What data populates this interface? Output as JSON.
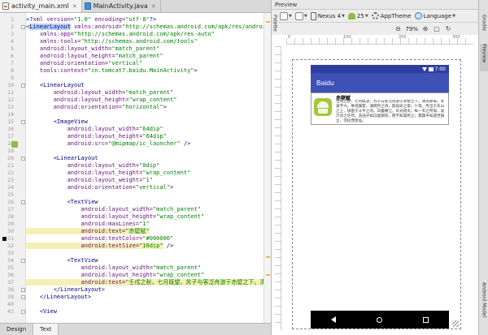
{
  "editor": {
    "tabs": [
      {
        "label": "activity_main.xml",
        "icon": "xml-file-icon",
        "active": true
      },
      {
        "label": "MainActivity.java",
        "icon": "java-file-icon",
        "active": false
      }
    ],
    "bottom_tabs": [
      "Design",
      "Text"
    ],
    "lines": [
      {
        "n": "1",
        "segs": [
          [
            "t",
            "<?"
          ],
          [
            "a",
            "xml version="
          ],
          [
            "v",
            "\"1.0\""
          ],
          [
            "a",
            " encoding="
          ],
          [
            "v",
            "\"utf-8\""
          ],
          [
            "t",
            "?>"
          ]
        ]
      },
      {
        "n": "2",
        "segs": [
          [
            "t",
            "<"
          ],
          [
            "sel",
            "LinearLayout"
          ],
          [
            "a",
            " xmlns:android="
          ],
          [
            "v",
            "\"http://schemas.android.com/apk/res/android\""
          ]
        ]
      },
      {
        "n": "3",
        "segs": [
          [
            "a",
            "    xmlns:app="
          ],
          [
            "v",
            "\"http://schemas.android.com/apk/res-auto\""
          ]
        ]
      },
      {
        "n": "4",
        "segs": [
          [
            "a",
            "    xmlns:tools="
          ],
          [
            "v",
            "\"http://schemas.android.com/tools\""
          ]
        ]
      },
      {
        "n": "5",
        "segs": [
          [
            "a",
            "    android:layout_width="
          ],
          [
            "v",
            "\"match_parent\""
          ]
        ]
      },
      {
        "n": "6",
        "segs": [
          [
            "a",
            "    android:layout_height="
          ],
          [
            "v",
            "\"match_parent\""
          ]
        ]
      },
      {
        "n": "7",
        "segs": [
          [
            "a",
            "    android:orientation="
          ],
          [
            "v",
            "\"vertical\""
          ]
        ]
      },
      {
        "n": "8",
        "segs": [
          [
            "a",
            "    tools:context="
          ],
          [
            "v",
            "\"cn.tomcat7.baidu.MainActivity\""
          ],
          [
            "t",
            ">"
          ]
        ]
      },
      {
        "n": "9",
        "segs": []
      },
      {
        "n": "10",
        "segs": [
          [
            "t",
            "    <LinearLayout"
          ]
        ]
      },
      {
        "n": "11",
        "segs": [
          [
            "a",
            "        android:layout_width="
          ],
          [
            "v",
            "\"match_parent\""
          ]
        ]
      },
      {
        "n": "12",
        "segs": [
          [
            "a",
            "        android:layout_height="
          ],
          [
            "v",
            "\"wrap_content\""
          ]
        ]
      },
      {
        "n": "13",
        "segs": [
          [
            "a",
            "        android:orientation="
          ],
          [
            "v",
            "\"horizontal\""
          ],
          [
            "t",
            ">"
          ]
        ]
      },
      {
        "n": "14",
        "segs": []
      },
      {
        "n": "15",
        "segs": [
          [
            "t",
            "        <ImageView"
          ]
        ]
      },
      {
        "n": "16",
        "segs": [
          [
            "a",
            "            android:layout_width="
          ],
          [
            "v",
            "\"64dip\""
          ]
        ]
      },
      {
        "n": "17",
        "segs": [
          [
            "a",
            "            android:layout_height="
          ],
          [
            "v",
            "\"64dip\""
          ]
        ]
      },
      {
        "n": "18",
        "segs": [
          [
            "a",
            "            android:src="
          ],
          [
            "v",
            "\"@mipmap/ic_launcher\""
          ],
          [
            "t",
            " />"
          ]
        ]
      },
      {
        "n": "19",
        "segs": []
      },
      {
        "n": "20",
        "segs": [
          [
            "t",
            "        <LinearLayout"
          ]
        ]
      },
      {
        "n": "21",
        "segs": [
          [
            "a",
            "            android:layout_width="
          ],
          [
            "v",
            "\"0dip\""
          ]
        ]
      },
      {
        "n": "22",
        "segs": [
          [
            "a",
            "            android:layout_height="
          ],
          [
            "v",
            "\"wrap_content\""
          ]
        ]
      },
      {
        "n": "23",
        "segs": [
          [
            "a",
            "            android:layout_weight="
          ],
          [
            "v",
            "\"1\""
          ]
        ]
      },
      {
        "n": "24",
        "segs": [
          [
            "a",
            "            android:orientation="
          ],
          [
            "v",
            "\"vertical\""
          ],
          [
            "t",
            ">"
          ]
        ]
      },
      {
        "n": "25",
        "segs": []
      },
      {
        "n": "26",
        "segs": [
          [
            "t",
            "            <TextView"
          ]
        ]
      },
      {
        "n": "27",
        "segs": [
          [
            "a",
            "                android:layout_width="
          ],
          [
            "v",
            "\"match_parent\""
          ]
        ]
      },
      {
        "n": "28",
        "segs": [
          [
            "a",
            "                android:layout_height="
          ],
          [
            "v",
            "\"wrap_content\""
          ]
        ]
      },
      {
        "n": "29",
        "segs": [
          [
            "a",
            "                android:maxLines="
          ],
          [
            "v",
            "\"1\""
          ]
        ]
      },
      {
        "n": "30",
        "segs": [
          [
            "ah",
            "                android:text="
          ],
          [
            "vh",
            "\"赤壁赋\""
          ]
        ]
      },
      {
        "n": "31",
        "segs": [
          [
            "a",
            "                android:textColor="
          ],
          [
            "v",
            "\"#000000\""
          ]
        ]
      },
      {
        "n": "32",
        "segs": [
          [
            "ah",
            "                android:textSize="
          ],
          [
            "vh",
            "\"16dip\""
          ],
          [
            "t",
            " />"
          ]
        ]
      },
      {
        "n": "33",
        "segs": []
      },
      {
        "n": "34",
        "segs": [
          [
            "t",
            "            <TextView"
          ]
        ]
      },
      {
        "n": "35",
        "segs": [
          [
            "a",
            "                android:layout_width="
          ],
          [
            "v",
            "\"match_parent\""
          ]
        ]
      },
      {
        "n": "36",
        "segs": [
          [
            "a",
            "                android:layout_height="
          ],
          [
            "v",
            "\"wrap_content\""
          ]
        ]
      },
      {
        "n": "37",
        "segs": [
          [
            "ah",
            "                android:text="
          ],
          [
            "vh",
            "\"壬戌之秋，七月既望，苏子与客泛舟游于赤壁之下。清风徐来"
          ]
        ]
      },
      {
        "n": "38",
        "segs": [
          [
            "t",
            "        </LinearLayout>"
          ]
        ]
      },
      {
        "n": "39",
        "segs": [
          [
            "t",
            "    </LinearLayout>"
          ]
        ]
      },
      {
        "n": "40",
        "segs": []
      },
      {
        "n": "41",
        "segs": [
          [
            "t",
            "    <View"
          ]
        ]
      }
    ]
  },
  "preview": {
    "title": "Preview",
    "device_label": "Nexus 4",
    "api_label": "25",
    "theme_label": "AppTheme",
    "language_label": "Language",
    "zoom_label": "79%",
    "side_tabs": [
      "Palette",
      "Gradle",
      "Preview",
      "Android Model"
    ],
    "ruler_labels": [
      "0",
      "100",
      "200",
      "300"
    ]
  },
  "phone": {
    "time": "7:00",
    "app_title": "Baidu",
    "item_title": "赤壁赋",
    "item_body": "壬戌之秋，七月既望，苏子与客泛舟游于赤壁之下。清风徐来，水波不兴。举酒属客，诵明月之诗，歌窈窕之章。少焉，月出于东山之上，徘徊于斗牛之间。白露横江，水光接天。纵一苇之所如，凌万顷之茫然。浩浩乎如冯虚御风，而不知其所止；飘飘乎如遗世独立，羽化而登仙。"
  },
  "colors": {
    "statusbar": "#303f9f",
    "appbar": "#3f51b5",
    "launcher": "#a4c639"
  }
}
